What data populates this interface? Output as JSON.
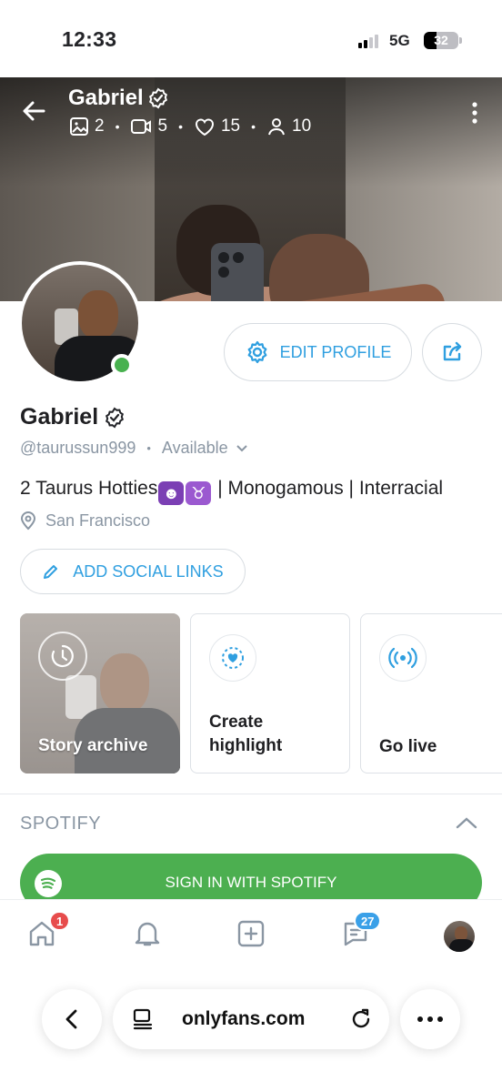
{
  "status_bar": {
    "time": "12:33",
    "network": "5G",
    "battery": "32"
  },
  "header": {
    "name": "Gabriel",
    "stats": {
      "photos": "2",
      "videos": "5",
      "likes": "15",
      "fans": "10"
    }
  },
  "profile": {
    "edit_label": "EDIT PROFILE",
    "name": "Gabriel",
    "handle": "@taurussun999",
    "availability": "Available",
    "bio_prefix": "2 Taurus Hotties",
    "bio_suffix": " | Monogamous | Interracial",
    "location": "San Francisco",
    "social_links_label": "ADD SOCIAL LINKS"
  },
  "highlights": [
    {
      "label": "Story archive"
    },
    {
      "label": "Create highlight"
    },
    {
      "label": "Go live"
    }
  ],
  "spotify": {
    "title": "SPOTIFY",
    "button_label": "SIGN IN WITH SPOTIFY",
    "color": "#4caf50"
  },
  "tabbar": {
    "notifications_badge": "1",
    "messages_badge": "27"
  },
  "browser": {
    "url": "onlyfans.com"
  },
  "colors": {
    "accent": "#2f9fe0",
    "online": "#48b14f",
    "badge_red": "#e74c4c",
    "badge_blue": "#3aa0e8"
  }
}
